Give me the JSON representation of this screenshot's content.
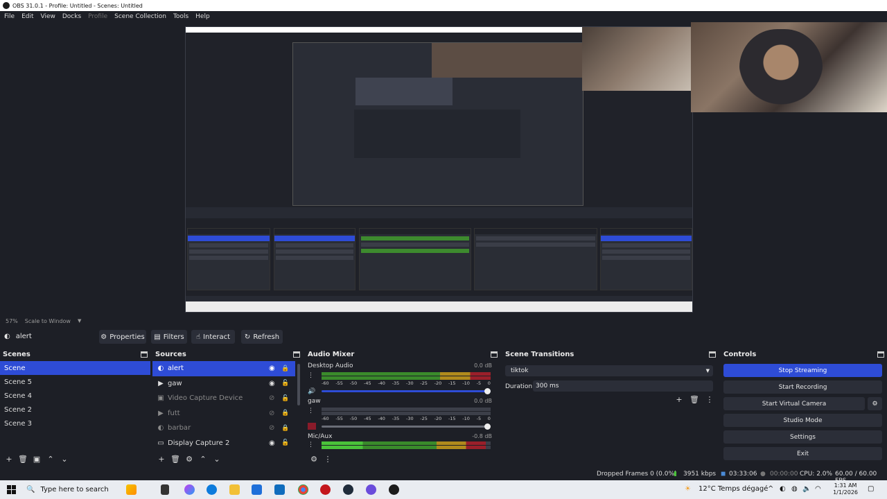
{
  "window": {
    "title": "OBS 31.0.1 - Profile: Untitled - Scenes: Untitled"
  },
  "menu": [
    "File",
    "Edit",
    "View",
    "Docks",
    "Profile",
    "Scene Collection",
    "Tools",
    "Help"
  ],
  "preview": {
    "zoom": "57%",
    "scale_mode": "Scale to Window"
  },
  "context": {
    "source": "alert",
    "properties": "Properties",
    "filters": "Filters",
    "interact": "Interact",
    "refresh": "Refresh"
  },
  "scenes": {
    "title": "Scenes",
    "items": [
      "Scene",
      "Scene 5",
      "Scene 4",
      "Scene 2",
      "Scene 3"
    ]
  },
  "sources": {
    "title": "Sources",
    "items": [
      {
        "name": "alert",
        "icon": "browser-icon"
      },
      {
        "name": "gaw",
        "icon": "play-icon"
      },
      {
        "name": "Video Capture Device",
        "icon": "camera-icon"
      },
      {
        "name": "futt",
        "icon": "play-icon"
      },
      {
        "name": "barbar",
        "icon": "browser-icon"
      },
      {
        "name": "Display Capture 2",
        "icon": "monitor-icon"
      }
    ]
  },
  "audio": {
    "title": "Audio Mixer",
    "ticks": [
      "-60",
      "-55",
      "-50",
      "-45",
      "-40",
      "-35",
      "-30",
      "-25",
      "-20",
      "-15",
      "-10",
      "-5",
      "0"
    ],
    "channels": [
      {
        "name": "Desktop Audio",
        "db": "0.0 dB",
        "level": 1.0
      },
      {
        "name": "gaw",
        "db": "0.0 dB",
        "level": 0.0
      },
      {
        "name": "Mic/Aux",
        "db": "-0.8 dB",
        "level": 0.97
      }
    ]
  },
  "transitions": {
    "title": "Scene Transitions",
    "selected": "tiktok",
    "duration_label": "Duration",
    "duration": "300 ms"
  },
  "controls": {
    "title": "Controls",
    "stop_streaming": "Stop Streaming",
    "start_recording": "Start Recording",
    "start_virtual_camera": "Start Virtual Camera",
    "studio_mode": "Studio Mode",
    "settings": "Settings",
    "exit": "Exit"
  },
  "status": {
    "dropped": "Dropped Frames 0 (0.0%)",
    "bitrate": "3951 kbps",
    "stream_time": "03:33:06",
    "rec_time": "00:00:00",
    "cpu": "CPU: 2.0%",
    "fps": "60.00 / 60.00 FPS"
  },
  "taskbar": {
    "search": "Type here to search",
    "weather": "12°C  Temps dégagé",
    "time": "1:31 AM",
    "date": "1/1/2026"
  },
  "colors": {
    "accent": "#2e4cd6",
    "bg": "#1d1f26",
    "panel": "#272a33",
    "button": "#2b2e38"
  }
}
